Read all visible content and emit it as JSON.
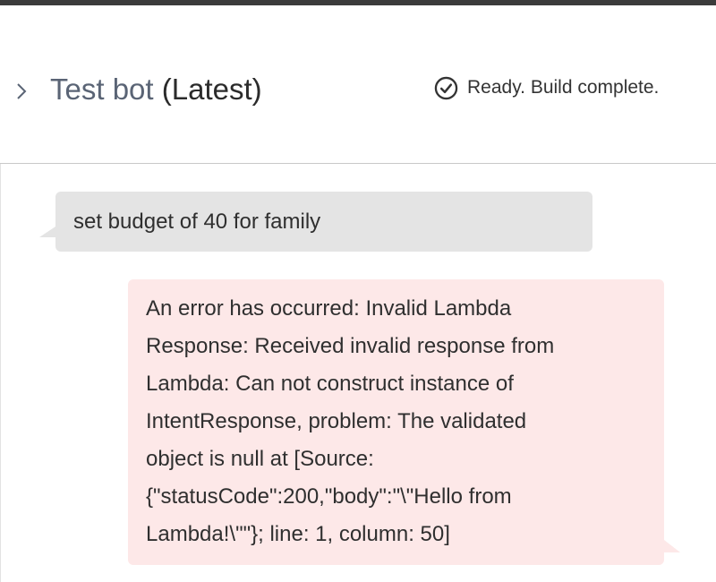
{
  "header": {
    "bot_name": "Test bot",
    "version_label": "(Latest)",
    "status_text": "Ready. Build complete.",
    "toggle_icon": "chevron-right-icon",
    "status_icon": "check-circle-icon"
  },
  "chat": {
    "messages": [
      {
        "role": "user",
        "text": "set budget of 40 for family"
      },
      {
        "role": "bot",
        "status": "error",
        "lines": [
          "An error has occurred: Invalid Lambda",
          "Response: Received invalid response from",
          "Lambda: Can not construct instance of",
          "IntentResponse, problem: The validated",
          "object is null at [Source:",
          "{\"statusCode\":200,\"body\":\"\\\"Hello from",
          "Lambda!\\\"\"}; line: 1, column: 50]"
        ]
      }
    ]
  },
  "colors": {
    "user_bubble": "#e4e4e4",
    "error_bubble": "#fde8e8",
    "bot_name": "#5a6475",
    "top_bar": "#3b3b3b"
  }
}
